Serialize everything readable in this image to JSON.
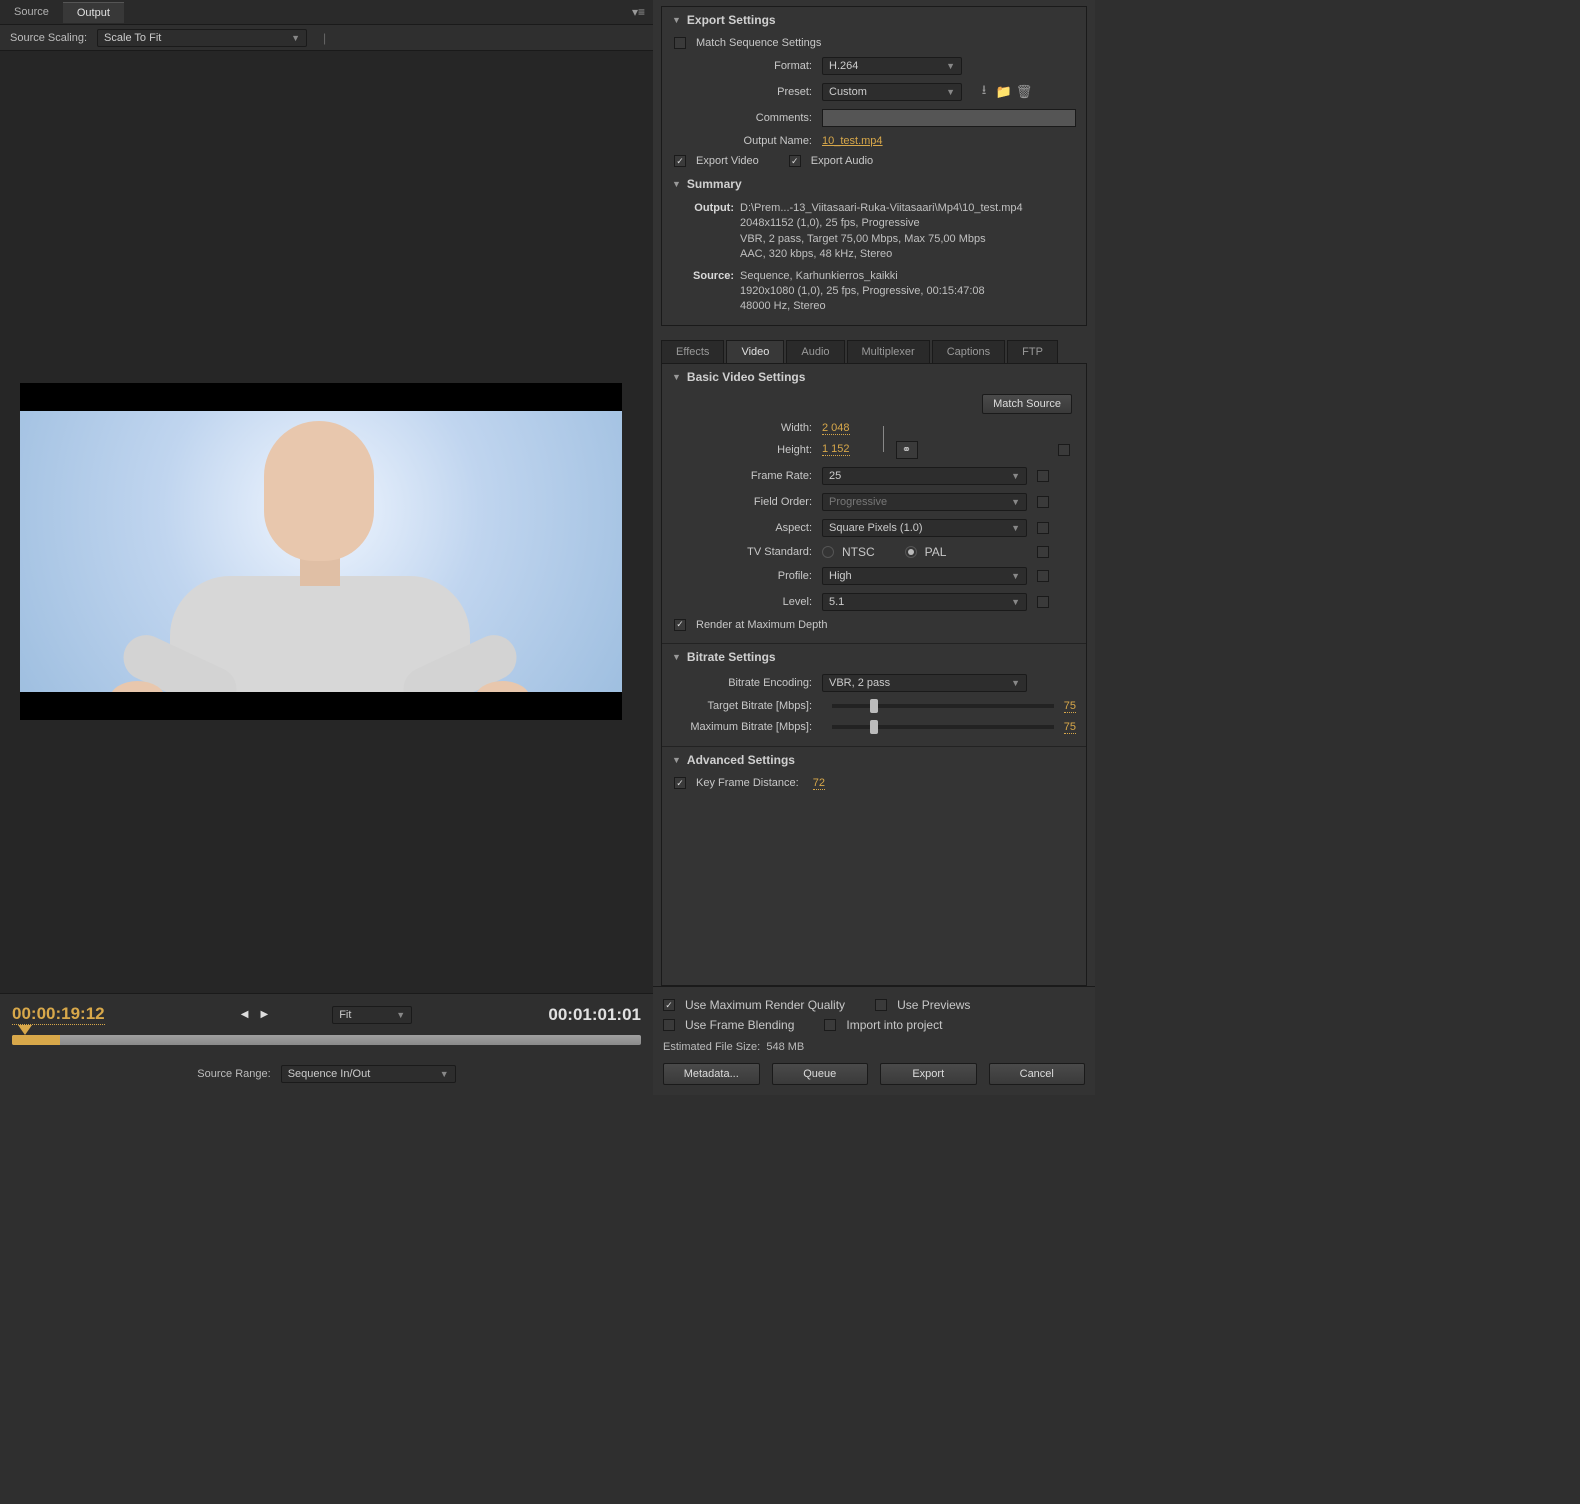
{
  "topTabs": {
    "source": "Source",
    "output": "Output"
  },
  "scaling": {
    "label": "Source Scaling:",
    "value": "Scale To Fit"
  },
  "timecode": {
    "in": "00:00:19:12",
    "out": "00:01:01:01",
    "fit": "Fit"
  },
  "sourceRange": {
    "label": "Source Range:",
    "value": "Sequence In/Out"
  },
  "exportSettings": {
    "title": "Export Settings",
    "matchSequence": "Match Sequence Settings",
    "formatLabel": "Format:",
    "formatValue": "H.264",
    "presetLabel": "Preset:",
    "presetValue": "Custom",
    "commentsLabel": "Comments:",
    "outputNameLabel": "Output Name:",
    "outputNameValue": "10_test.mp4",
    "exportVideo": "Export Video",
    "exportAudio": "Export Audio"
  },
  "summary": {
    "title": "Summary",
    "outputLabel": "Output:",
    "outputPath": "D:\\Prem...-13_Viitasaari-Ruka-Viitasaari\\Mp4\\10_test.mp4",
    "outputL2": "2048x1152 (1,0), 25 fps, Progressive",
    "outputL3": "VBR, 2 pass, Target 75,00 Mbps, Max 75,00 Mbps",
    "outputL4": "AAC, 320 kbps, 48 kHz, Stereo",
    "sourceLabel": "Source:",
    "sourceL1": "Sequence, Karhunkierros_kaikki",
    "sourceL2": "1920x1080 (1,0), 25 fps, Progressive, 00:15:47:08",
    "sourceL3": "48000 Hz, Stereo"
  },
  "lowerTabs": {
    "effects": "Effects",
    "video": "Video",
    "audio": "Audio",
    "multiplexer": "Multiplexer",
    "captions": "Captions",
    "ftp": "FTP"
  },
  "basicVideo": {
    "title": "Basic Video Settings",
    "matchSource": "Match Source",
    "widthLabel": "Width:",
    "widthValue": "2 048",
    "heightLabel": "Height:",
    "heightValue": "1 152",
    "frameRateLabel": "Frame Rate:",
    "frameRateValue": "25",
    "fieldOrderLabel": "Field Order:",
    "fieldOrderValue": "Progressive",
    "aspectLabel": "Aspect:",
    "aspectValue": "Square Pixels (1.0)",
    "tvStdLabel": "TV Standard:",
    "ntsc": "NTSC",
    "pal": "PAL",
    "profileLabel": "Profile:",
    "profileValue": "High",
    "levelLabel": "Level:",
    "levelValue": "5.1",
    "renderMaxDepth": "Render at Maximum Depth"
  },
  "bitrate": {
    "title": "Bitrate Settings",
    "encodingLabel": "Bitrate Encoding:",
    "encodingValue": "VBR, 2 pass",
    "targetLabel": "Target Bitrate [Mbps]:",
    "targetValue": "75",
    "maxLabel": "Maximum Bitrate [Mbps]:",
    "maxValue": "75"
  },
  "advanced": {
    "title": "Advanced Settings",
    "keyFrameLabel": "Key Frame Distance:",
    "keyFrameValue": "72"
  },
  "footer": {
    "useMaxQuality": "Use Maximum Render Quality",
    "usePreviews": "Use Previews",
    "useFrameBlending": "Use Frame Blending",
    "importProject": "Import into project",
    "estLabel": "Estimated File Size:",
    "estValue": "548 MB",
    "metadata": "Metadata...",
    "queue": "Queue",
    "export": "Export",
    "cancel": "Cancel"
  }
}
